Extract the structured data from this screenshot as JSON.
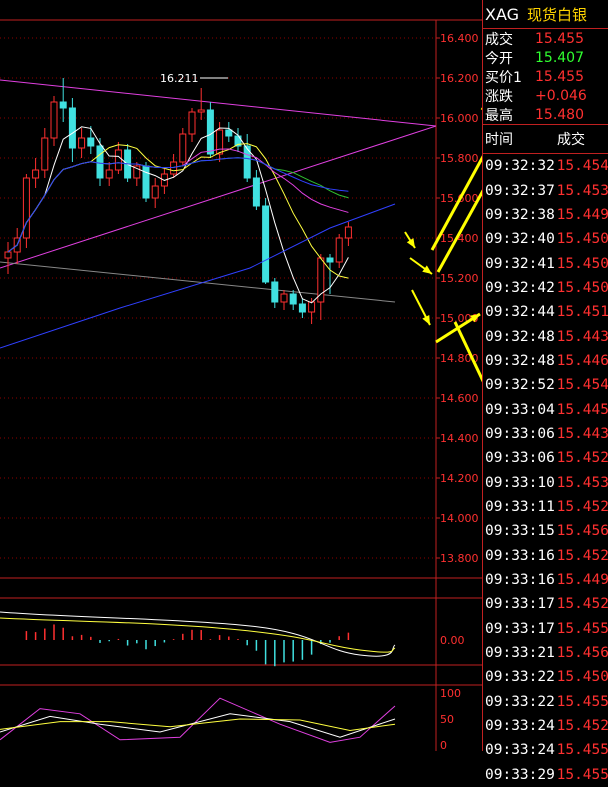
{
  "quote": {
    "symbol": "XAG",
    "name": "现货白银",
    "rows": [
      {
        "label": "成交",
        "value": "15.455",
        "color": "#ff3030"
      },
      {
        "label": "今开",
        "value": "15.407",
        "color": "#30ff30"
      },
      {
        "label": "买价1",
        "value": "15.455",
        "color": "#ff3030"
      },
      {
        "label": "涨跌",
        "value": "+0.046",
        "color": "#ff3030"
      },
      {
        "label": "最高",
        "value": "15.480",
        "color": "#ff3030"
      }
    ]
  },
  "trades": {
    "col_time": "时间",
    "col_price": "成交",
    "rows": [
      {
        "time": "09:32:32",
        "price": "15.454"
      },
      {
        "time": "09:32:37",
        "price": "15.453"
      },
      {
        "time": "09:32:38",
        "price": "15.449"
      },
      {
        "time": "09:32:40",
        "price": "15.450"
      },
      {
        "time": "09:32:41",
        "price": "15.450"
      },
      {
        "time": "09:32:42",
        "price": "15.450"
      },
      {
        "time": "09:32:44",
        "price": "15.451"
      },
      {
        "time": "09:32:48",
        "price": "15.443"
      },
      {
        "time": "09:32:48",
        "price": "15.446"
      },
      {
        "time": "09:32:52",
        "price": "15.454"
      },
      {
        "time": "09:33:04",
        "price": "15.445"
      },
      {
        "time": "09:33:06",
        "price": "15.443"
      },
      {
        "time": "09:33:06",
        "price": "15.452"
      },
      {
        "time": "09:33:10",
        "price": "15.453"
      },
      {
        "time": "09:33:11",
        "price": "15.452"
      },
      {
        "time": "09:33:15",
        "price": "15.456"
      },
      {
        "time": "09:33:16",
        "price": "15.452"
      },
      {
        "time": "09:33:16",
        "price": "15.449"
      },
      {
        "time": "09:33:17",
        "price": "15.452"
      },
      {
        "time": "09:33:17",
        "price": "15.455"
      },
      {
        "time": "09:33:21",
        "price": "15.456"
      },
      {
        "time": "09:33:22",
        "price": "15.450"
      },
      {
        "time": "09:33:22",
        "price": "15.455"
      },
      {
        "time": "09:33:24",
        "price": "15.452"
      },
      {
        "time": "09:33:24",
        "price": "15.455"
      },
      {
        "time": "09:33:29",
        "price": "15.455"
      }
    ]
  },
  "chart_data": {
    "type": "candlestick",
    "high_label": "16.211",
    "price_axis": {
      "ticks": [
        "16.400",
        "16.200",
        "16.000",
        "15.800",
        "15.600",
        "15.400",
        "15.200",
        "15.000",
        "14.800",
        "14.600",
        "14.400",
        "14.200",
        "14.000",
        "13.800"
      ],
      "range": [
        13.7,
        16.4
      ]
    },
    "macd_axis": {
      "ticks": [
        "0.00"
      ]
    },
    "kdj_axis": {
      "ticks": [
        "100",
        "50",
        "0"
      ]
    },
    "candles": [
      {
        "o": 15.3,
        "h": 15.38,
        "l": 15.22,
        "c": 15.33
      },
      {
        "o": 15.33,
        "h": 15.45,
        "l": 15.27,
        "c": 15.4
      },
      {
        "o": 15.4,
        "h": 15.72,
        "l": 15.35,
        "c": 15.7
      },
      {
        "o": 15.7,
        "h": 15.8,
        "l": 15.65,
        "c": 15.74
      },
      {
        "o": 15.74,
        "h": 15.95,
        "l": 15.7,
        "c": 15.9
      },
      {
        "o": 15.9,
        "h": 16.11,
        "l": 15.86,
        "c": 16.08
      },
      {
        "o": 16.08,
        "h": 16.2,
        "l": 15.98,
        "c": 16.05
      },
      {
        "o": 16.05,
        "h": 16.1,
        "l": 15.78,
        "c": 15.85
      },
      {
        "o": 15.85,
        "h": 15.95,
        "l": 15.8,
        "c": 15.9
      },
      {
        "o": 15.9,
        "h": 15.96,
        "l": 15.82,
        "c": 15.86
      },
      {
        "o": 15.86,
        "h": 15.9,
        "l": 15.66,
        "c": 15.7
      },
      {
        "o": 15.7,
        "h": 15.78,
        "l": 15.66,
        "c": 15.74
      },
      {
        "o": 15.74,
        "h": 15.88,
        "l": 15.72,
        "c": 15.84
      },
      {
        "o": 15.84,
        "h": 15.87,
        "l": 15.68,
        "c": 15.7
      },
      {
        "o": 15.7,
        "h": 15.78,
        "l": 15.66,
        "c": 15.76
      },
      {
        "o": 15.76,
        "h": 15.78,
        "l": 15.58,
        "c": 15.6
      },
      {
        "o": 15.6,
        "h": 15.7,
        "l": 15.55,
        "c": 15.66
      },
      {
        "o": 15.66,
        "h": 15.75,
        "l": 15.62,
        "c": 15.72
      },
      {
        "o": 15.72,
        "h": 15.82,
        "l": 15.7,
        "c": 15.78
      },
      {
        "o": 15.78,
        "h": 15.95,
        "l": 15.76,
        "c": 15.92
      },
      {
        "o": 15.92,
        "h": 16.05,
        "l": 15.88,
        "c": 16.03
      },
      {
        "o": 16.03,
        "h": 16.15,
        "l": 15.99,
        "c": 16.04
      },
      {
        "o": 16.04,
        "h": 16.08,
        "l": 15.8,
        "c": 15.82
      },
      {
        "o": 15.82,
        "h": 15.98,
        "l": 15.78,
        "c": 15.94
      },
      {
        "o": 15.94,
        "h": 15.98,
        "l": 15.88,
        "c": 15.91
      },
      {
        "o": 15.91,
        "h": 15.95,
        "l": 15.83,
        "c": 15.86
      },
      {
        "o": 15.86,
        "h": 15.92,
        "l": 15.68,
        "c": 15.7
      },
      {
        "o": 15.7,
        "h": 15.74,
        "l": 15.54,
        "c": 15.56
      },
      {
        "o": 15.56,
        "h": 15.6,
        "l": 15.17,
        "c": 15.18
      },
      {
        "o": 15.18,
        "h": 15.2,
        "l": 15.05,
        "c": 15.08
      },
      {
        "o": 15.08,
        "h": 15.14,
        "l": 15.04,
        "c": 15.12
      },
      {
        "o": 15.12,
        "h": 15.14,
        "l": 15.04,
        "c": 15.07
      },
      {
        "o": 15.07,
        "h": 15.1,
        "l": 15.0,
        "c": 15.03
      },
      {
        "o": 15.03,
        "h": 15.1,
        "l": 14.97,
        "c": 15.08
      },
      {
        "o": 15.08,
        "h": 15.32,
        "l": 14.99,
        "c": 15.3
      },
      {
        "o": 15.3,
        "h": 15.32,
        "l": 15.12,
        "c": 15.28
      },
      {
        "o": 15.28,
        "h": 15.42,
        "l": 15.25,
        "c": 15.4
      },
      {
        "o": 15.4,
        "h": 15.48,
        "l": 15.36,
        "c": 15.455
      }
    ],
    "colors": {
      "up": "#ff3030",
      "down": "#40e0e0",
      "grid": "#8b0000",
      "axis": "#c02020"
    }
  }
}
